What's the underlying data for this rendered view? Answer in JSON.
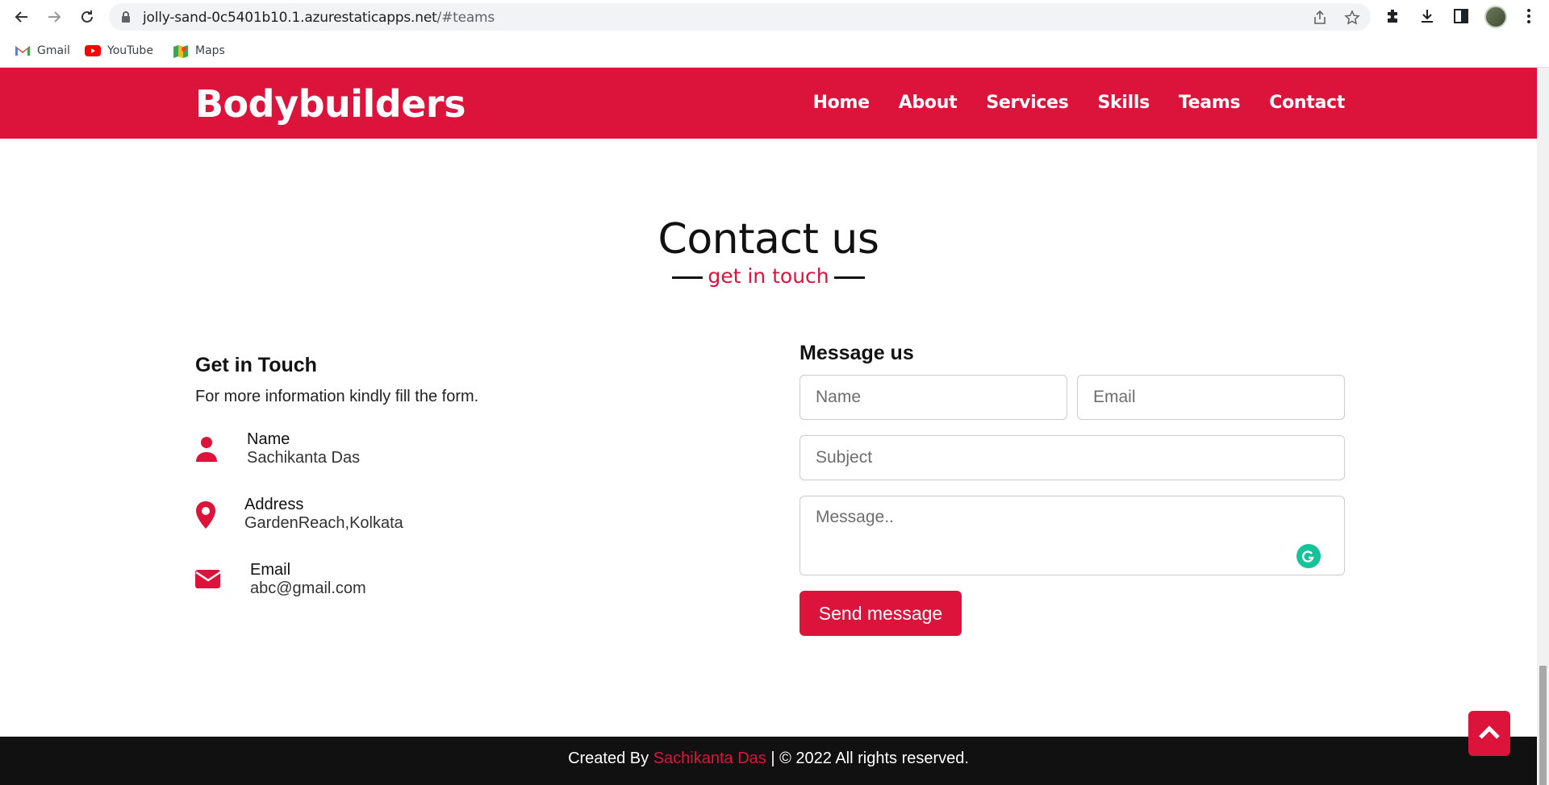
{
  "browser": {
    "url_host": "jolly-sand-0c5401b10.1.azurestaticapps.net",
    "url_path": "/#teams",
    "bookmarks": [
      {
        "label": "Gmail",
        "icon": "gmail-icon"
      },
      {
        "label": "YouTube",
        "icon": "youtube-icon"
      },
      {
        "label": "Maps",
        "icon": "maps-icon"
      }
    ]
  },
  "navbar": {
    "brand": "Bodybuilders",
    "links": [
      "Home",
      "About",
      "Services",
      "Skills",
      "Teams",
      "Contact"
    ]
  },
  "section": {
    "title": "Contact us",
    "subtitle": "get in touch"
  },
  "get_in_touch": {
    "heading": "Get in Touch",
    "text": "For more information kindly fill the form.",
    "items": [
      {
        "label": "Name",
        "value": "Sachikanta Das",
        "icon": "user-icon"
      },
      {
        "label": "Address",
        "value": "GardenReach,Kolkata",
        "icon": "map-pin-icon"
      },
      {
        "label": "Email",
        "value": "abc@gmail.com",
        "icon": "envelope-icon"
      }
    ]
  },
  "form": {
    "heading": "Message us",
    "name_placeholder": "Name",
    "email_placeholder": "Email",
    "subject_placeholder": "Subject",
    "message_placeholder": "Message..",
    "submit_label": "Send message"
  },
  "footer": {
    "prefix": "Created By",
    "author": "Sachikanta Das",
    "suffix": "| © 2022 All rights reserved."
  },
  "colors": {
    "accent": "#dc143c",
    "footer_bg": "#111111"
  }
}
